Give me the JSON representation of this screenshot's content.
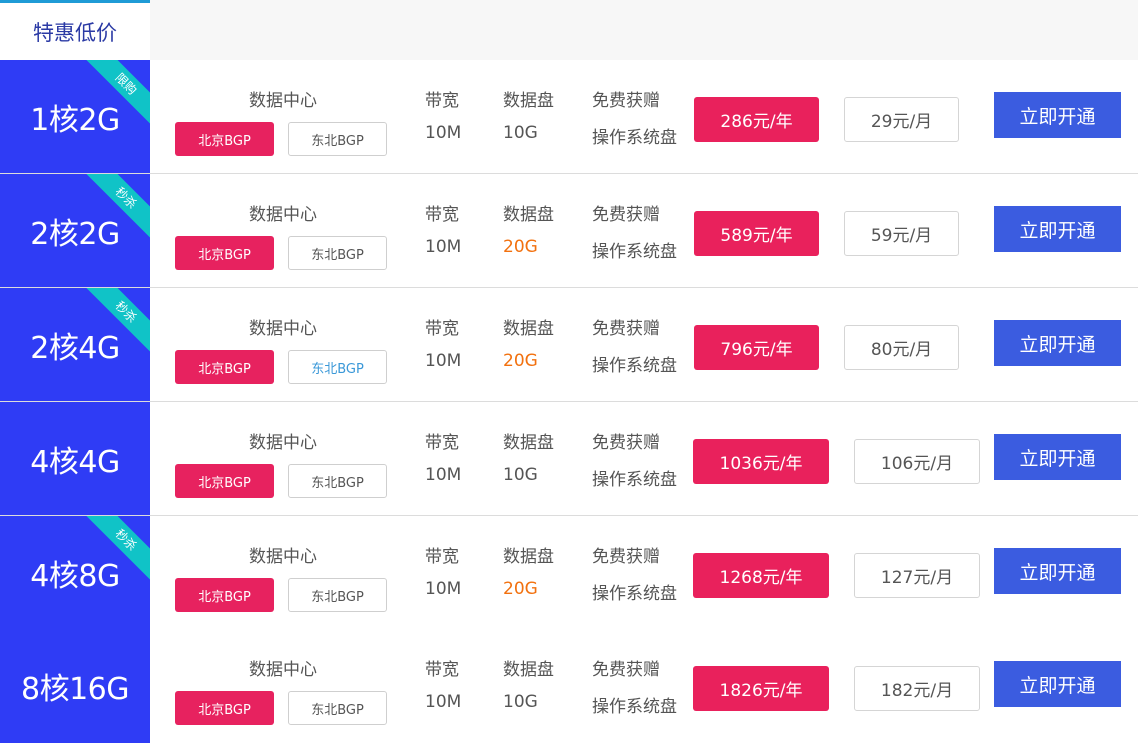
{
  "tab": {
    "label": "特惠低价"
  },
  "labels": {
    "dc": "数据中心",
    "bw": "带宽",
    "disk": "数据盘",
    "gift": "免费获赠",
    "os": "操作系统盘"
  },
  "colors": {
    "spec_bg": "#2f3cf5",
    "ribbon": "#10c3c7",
    "active_tag": "#e7225f",
    "price_year": "#e9215c",
    "open_btn": "#3b5ce0",
    "highlight_disk": "#f2710f"
  },
  "rows": [
    {
      "spec": "1核2G",
      "ribbon": "限购",
      "dc_active": "北京BGP",
      "dc_inactive": "东北BGP",
      "bandwidth": "10M",
      "disk": "10G",
      "price_year": "286元/年",
      "price_month": "29元/月",
      "button": "立即开通"
    },
    {
      "spec": "2核2G",
      "ribbon": "秒杀",
      "dc_active": "北京BGP",
      "dc_inactive": "东北BGP",
      "bandwidth": "10M",
      "disk": "20G",
      "price_year": "589元/年",
      "price_month": "59元/月",
      "button": "立即开通"
    },
    {
      "spec": "2核4G",
      "ribbon": "秒杀",
      "dc_active": "北京BGP",
      "dc_inactive": "东北BGP",
      "bandwidth": "10M",
      "disk": "20G",
      "price_year": "796元/年",
      "price_month": "80元/月",
      "button": "立即开通"
    },
    {
      "spec": "4核4G",
      "ribbon": "",
      "dc_active": "北京BGP",
      "dc_inactive": "东北BGP",
      "bandwidth": "10M",
      "disk": "10G",
      "price_year": "1036元/年",
      "price_month": "106元/月",
      "button": "立即开通"
    },
    {
      "spec": "4核8G",
      "ribbon": "秒杀",
      "dc_active": "北京BGP",
      "dc_inactive": "东北BGP",
      "bandwidth": "10M",
      "disk": "20G",
      "price_year": "1268元/年",
      "price_month": "127元/月",
      "button": "立即开通"
    },
    {
      "spec": "8核16G",
      "ribbon": "",
      "dc_active": "北京BGP",
      "dc_inactive": "东北BGP",
      "bandwidth": "10M",
      "disk": "10G",
      "price_year": "1826元/年",
      "price_month": "182元/月",
      "button": "立即开通"
    }
  ]
}
